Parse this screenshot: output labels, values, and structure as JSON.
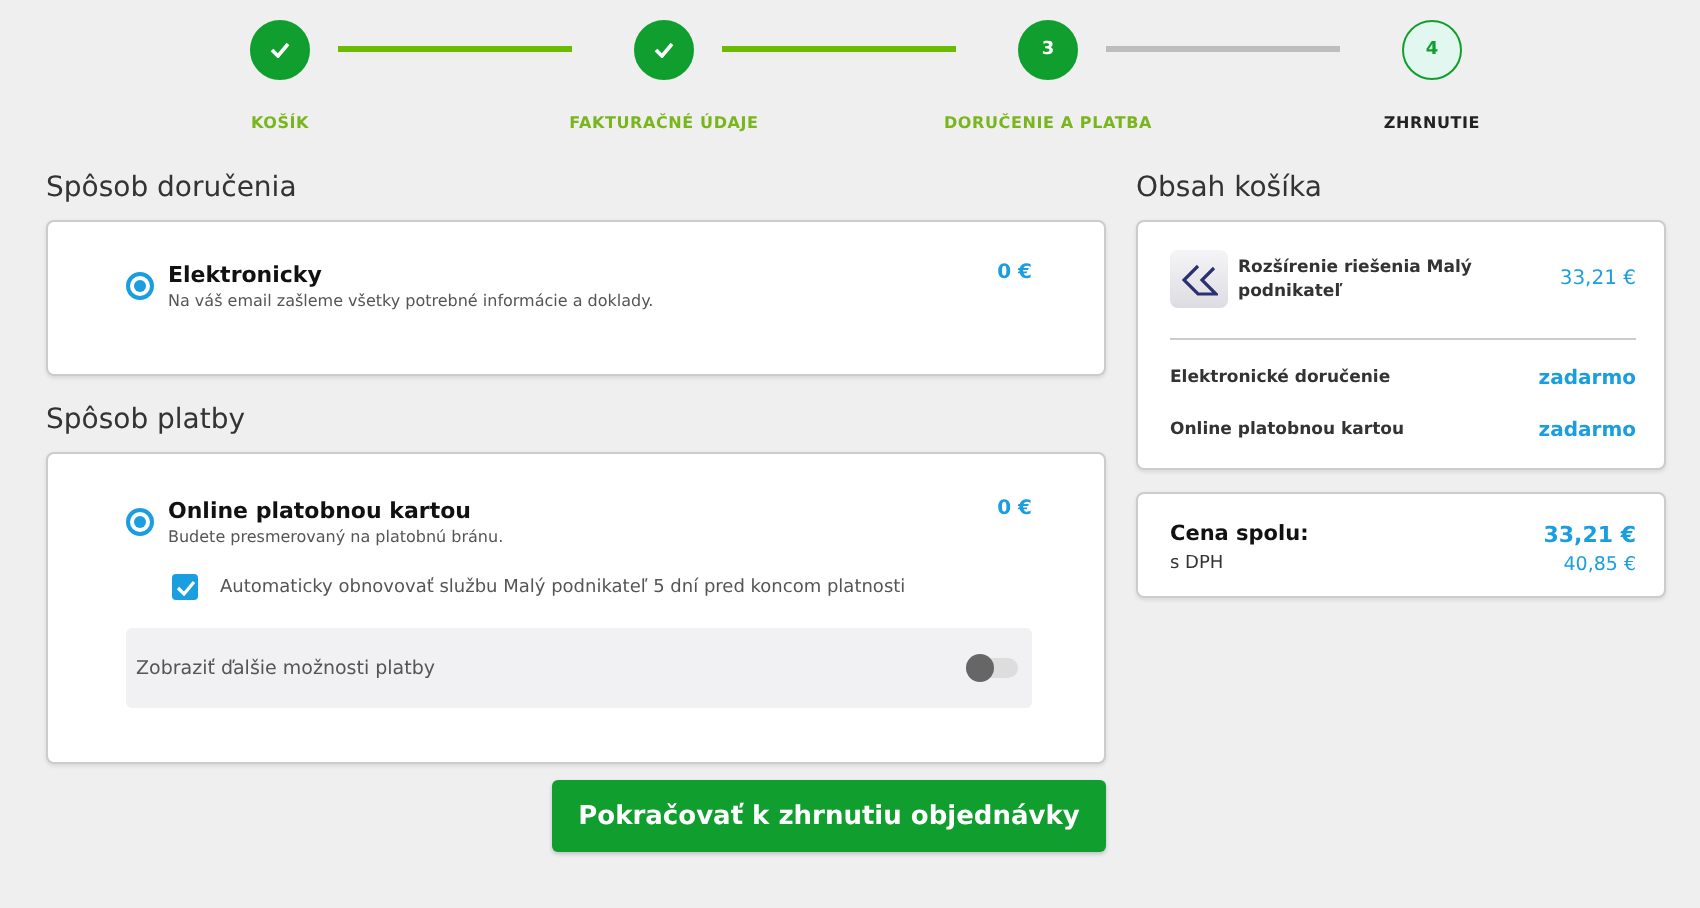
{
  "steps": [
    {
      "label": "KOŠÍK",
      "kind": "done"
    },
    {
      "label": "FAKTURAČNÉ ÚDAJE",
      "kind": "done"
    },
    {
      "label": "DORUČENIE A PLATBA",
      "kind": "current",
      "number": "3"
    },
    {
      "label": "ZHRNUTIE",
      "kind": "upcoming",
      "number": "4"
    }
  ],
  "delivery": {
    "heading": "Spôsob doručenia",
    "options": [
      {
        "title": "Elektronicky",
        "description": "Na váš email zašleme všetky potrebné informácie a doklady.",
        "price": "0 €",
        "selected": true
      }
    ]
  },
  "payment": {
    "heading": "Spôsob platby",
    "options": [
      {
        "title": "Online platobnou kartou",
        "description": "Budete presmerovaný na platobnú bránu.",
        "price": "0 €",
        "selected": true
      }
    ],
    "auto_renew": {
      "label": "Automaticky obnovovať službu Malý podnikateľ 5 dní pred koncom platnosti",
      "checked": true
    },
    "more_options": {
      "label": "Zobraziť ďalšie možnosti platby",
      "on": false
    }
  },
  "continue_button": "Pokračovať k zhrnutiu objednávky",
  "cart": {
    "heading": "Obsah košíka",
    "product": {
      "name": "Rozšírenie riešenia Malý podnikateľ",
      "price": "33,21 €"
    },
    "lines": [
      {
        "label": "Elektronické doručenie",
        "value": "zadarmo"
      },
      {
        "label": "Online platobnou kartou",
        "value": "zadarmo"
      }
    ],
    "total": {
      "label": "Cena spolu:",
      "value": "33,21 €",
      "vat_label": "s DPH",
      "vat_value": "40,85 €"
    }
  }
}
